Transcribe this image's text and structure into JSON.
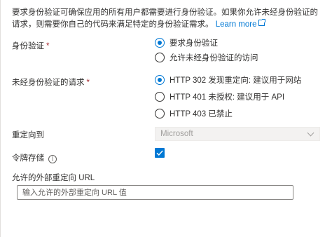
{
  "intro": {
    "text": "要求身份验证可确保应用的所有用户都需要进行身份验证。如果你允许未经身份验证的请求，则需要你自己的代码来满足特定的身份验证需求。",
    "link_label": "Learn more"
  },
  "authentication": {
    "label": "身份验证",
    "required_mark": "*",
    "options": [
      {
        "label": "要求身份验证",
        "checked": true
      },
      {
        "label": "允许未经身份验证的访问",
        "checked": false
      }
    ]
  },
  "unauthenticated_requests": {
    "label": "未经身份验证的请求",
    "required_mark": "*",
    "options": [
      {
        "label": "HTTP 302 发现重定向: 建议用于网站",
        "checked": true
      },
      {
        "label": "HTTP 401 未授权: 建议用于 API",
        "checked": false
      },
      {
        "label": "HTTP 403 已禁止",
        "checked": false
      }
    ]
  },
  "redirect_to": {
    "label": "重定向到",
    "value": "Microsoft"
  },
  "token_store": {
    "label": "令牌存储",
    "info_icon": "i",
    "checked": true
  },
  "allowed_redirect": {
    "label": "允许的外部重定向 URL",
    "placeholder": "输入允许的外部重定向 URL 值"
  },
  "colors": {
    "accent": "#0078d4",
    "required": "#a4262c",
    "disabled_bg": "#f3f2f1"
  }
}
